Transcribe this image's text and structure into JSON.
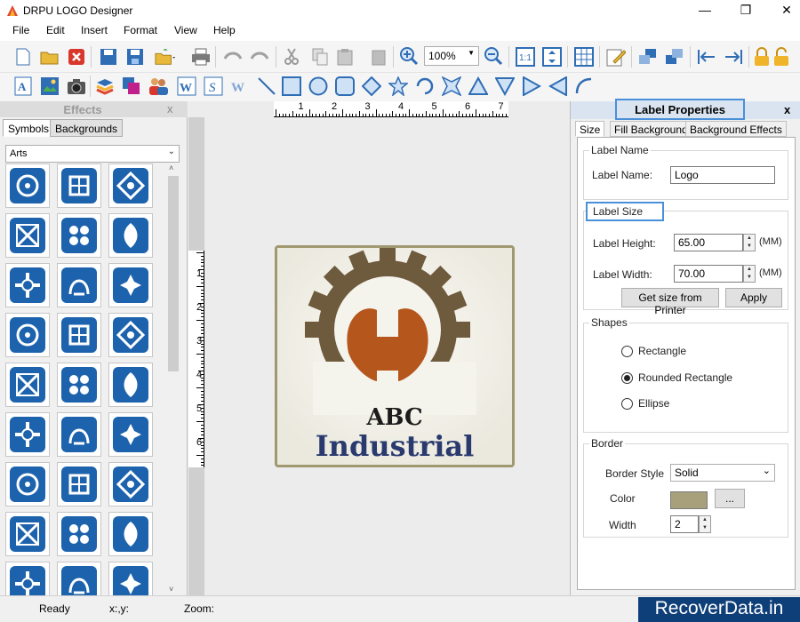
{
  "window": {
    "title": "DRPU LOGO Designer",
    "controls": [
      "minimize-icon",
      "maximize-icon",
      "close-icon"
    ]
  },
  "menu": [
    "File",
    "Edit",
    "Insert",
    "Format",
    "View",
    "Help"
  ],
  "toolbar": {
    "zoom_value": "100%",
    "row1_icons": [
      "new-file-icon",
      "open-folder-icon",
      "close-red-icon",
      "save-icon",
      "save-as-icon",
      "export-icon",
      "print-icon",
      "undo-icon",
      "redo-icon",
      "cut-icon",
      "copy-icon",
      "paste-icon",
      "delete-icon",
      "zoom-in-icon",
      "zoom-out-icon",
      "actual-size-icon",
      "fit-window-icon",
      "grid-icon",
      "edit-icon",
      "bring-forward-icon",
      "send-backward-icon",
      "align-left-icon",
      "align-right-icon",
      "lock-icon",
      "unlock-icon"
    ],
    "row2_icons": [
      "text-icon",
      "image-icon",
      "camera-icon",
      "layers-icon",
      "color-icon",
      "users-icon",
      "word-art-icon",
      "signature-icon",
      "watermark-icon",
      "line-icon",
      "rectangle-icon",
      "circle-icon",
      "rounded-rect-icon",
      "diamond-icon",
      "star-icon",
      "arc-icon",
      "burst-icon",
      "triangle-up-icon",
      "triangle-down-icon",
      "triangle-right-icon",
      "triangle-left-icon",
      "curve-icon"
    ]
  },
  "effects_panel": {
    "title": "Effects",
    "close": "x",
    "tabs": [
      "Symbols",
      "Backgrounds"
    ],
    "category": "Arts",
    "symbol_count": 27
  },
  "canvas": {
    "ruler_h": [
      "1",
      "2",
      "3",
      "4",
      "5",
      "6",
      "7"
    ],
    "ruler_v": [
      "1",
      "2",
      "3",
      "4",
      "5",
      "6"
    ],
    "logo_line1": "ABC",
    "logo_line2": "Industrial",
    "colors": {
      "gear": "#6e5a3c",
      "wrench": "#b5561c",
      "text_dark": "#1c1c1c",
      "text_navy": "#2a3a6e",
      "border": "#a09870"
    }
  },
  "props_panel": {
    "title": "Label Properties",
    "close": "x",
    "tabs": [
      "Size",
      "Fill Background",
      "Background Effects"
    ],
    "label_name_group": "Label Name",
    "label_name_label": "Label Name:",
    "label_name_value": "Logo",
    "label_size_group": "Label Size",
    "height_label": "Label Height:",
    "height_value": "65.00",
    "width_label": "Label Width:",
    "width_value": "70.00",
    "unit": "(MM)",
    "btn_printer": "Get size from Printer",
    "btn_apply": "Apply",
    "shapes_group": "Shapes",
    "shape_options": [
      "Rectangle",
      "Rounded Rectangle",
      "Ellipse"
    ],
    "shape_selected": "Rounded Rectangle",
    "border_group": "Border",
    "border_style_label": "Border Style",
    "border_style_value": "Solid",
    "color_label": "Color",
    "color_value": "#a8a07a",
    "color_btn": "...",
    "width_label2": "Width",
    "width_value2": "2"
  },
  "status": {
    "ready": "Ready",
    "coords": "x:,y:",
    "zoom": "Zoom:"
  },
  "watermark": "RecoverData.in"
}
